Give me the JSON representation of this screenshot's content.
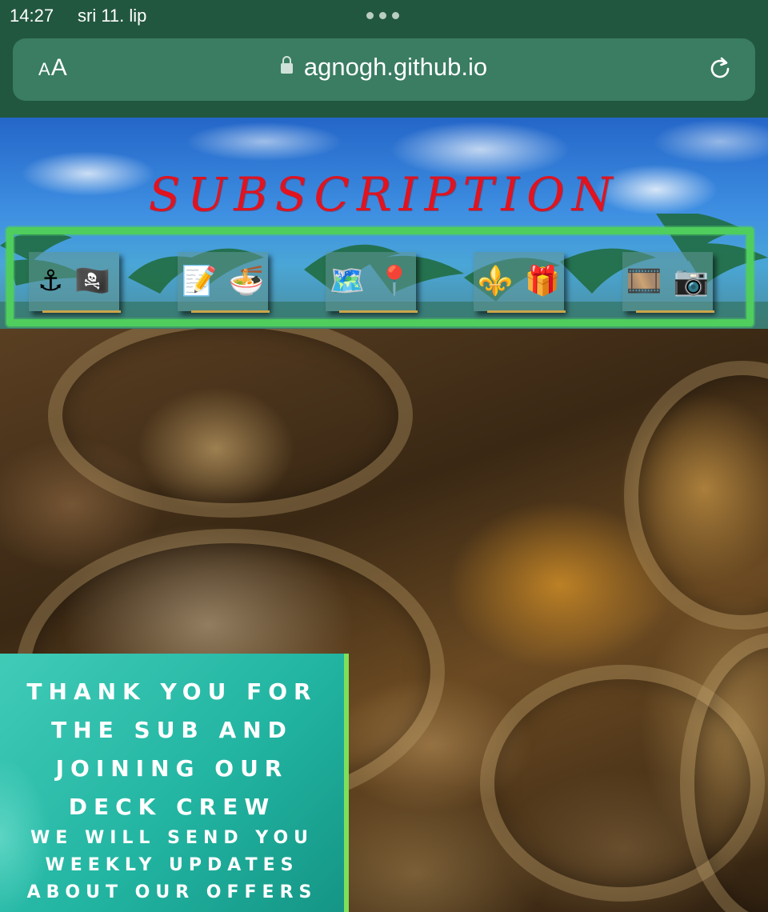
{
  "status_bar": {
    "time": "14:27",
    "date": "sri 11. lip"
  },
  "browser": {
    "text_size_button": {
      "small": "A",
      "large": "A"
    },
    "url": "agnogh.github.io",
    "icons": [
      "lock-icon",
      "reload-icon",
      "more-dots-icon"
    ]
  },
  "site": {
    "title": "SUBSCRIPTION",
    "nav": [
      {
        "name": "anchor-pirate-flag",
        "glyphs": [
          "⚓",
          "🏴‍☠️"
        ]
      },
      {
        "name": "memo-food",
        "glyphs": [
          "📝",
          "🍜"
        ]
      },
      {
        "name": "map-pin",
        "glyphs": [
          "🗺️",
          "📍"
        ]
      },
      {
        "name": "fleur-de-lis-gift",
        "glyphs": [
          "⚜️",
          "🎁"
        ]
      },
      {
        "name": "film-camera",
        "glyphs": [
          "🎞️",
          "📷"
        ]
      }
    ]
  },
  "thanks": {
    "title_lines": [
      "THANK YOU FOR",
      "THE SUB AND",
      "JOINING OUR",
      "DECK CREW"
    ],
    "sub_lines": [
      "WE WILL SEND YOU",
      "WEEKLY UPDATES",
      "ABOUT OUR OFFERS"
    ]
  },
  "colors": {
    "title_red": "#e0131f",
    "frame_green": "#4fce5e",
    "card_teal": "#22b5a2",
    "browser_green": "#22573f"
  }
}
